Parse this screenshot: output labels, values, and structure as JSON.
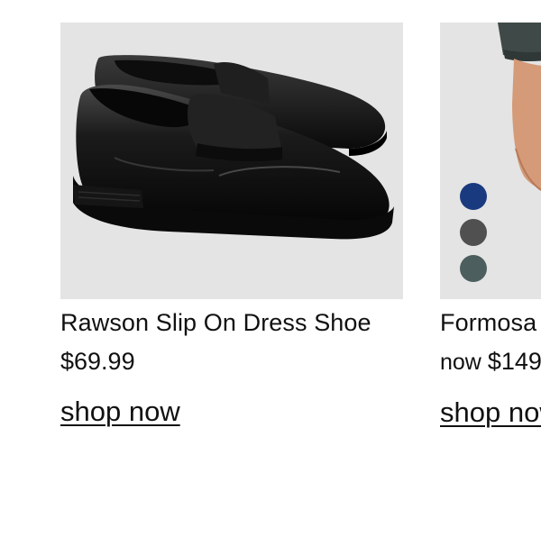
{
  "products": [
    {
      "title": "Rawson Slip On Dress Shoe",
      "price": "$69.99",
      "cta": "shop now",
      "image": "black-penny-loafer-image"
    },
    {
      "title": "Formosa",
      "price_prefix": "now ",
      "price": "$149",
      "cta": "shop now",
      "image": "model-in-suit-image",
      "swatches": [
        {
          "name": "navy",
          "color": "#1a3a80"
        },
        {
          "name": "charcoal",
          "color": "#505050"
        },
        {
          "name": "slate",
          "color": "#4d5e5e"
        }
      ]
    }
  ]
}
